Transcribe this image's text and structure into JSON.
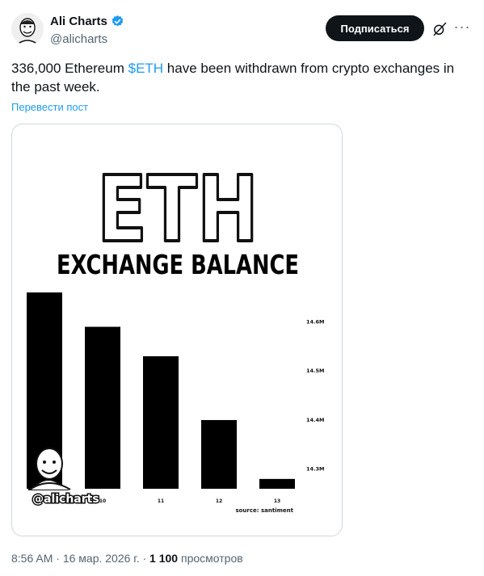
{
  "author": {
    "display_name": "Ali Charts",
    "handle": "@alicharts"
  },
  "actions": {
    "subscribe_label": "Подписаться"
  },
  "tweet": {
    "text_before": "336,000 Ethereum ",
    "cashtag": "$ETH",
    "text_after": " have been withdrawn from crypto exchanges in the past week.",
    "translate_label": "Перевести пост"
  },
  "meta": {
    "time": "8:56 AM",
    "date": "16 мар. 2026 г.",
    "views_count": "1 100",
    "views_label": "просмотров"
  },
  "image": {
    "big_title": "ETH",
    "subtitle": "EXCHANGE BALANCE",
    "watermark": "@alicharts",
    "source_note": "source: santiment"
  },
  "colors": {
    "accent": "#1d9bf0",
    "text": "#0f1419",
    "muted": "#536471",
    "bar": "#000000"
  },
  "chart_data": {
    "type": "bar",
    "categories": [
      "9",
      "10",
      "11",
      "12",
      "13"
    ],
    "category_labels_shown": [
      "",
      "10",
      "11",
      "12",
      "13"
    ],
    "values": [
      14.66,
      14.59,
      14.53,
      14.4,
      14.28
    ],
    "unit": "M",
    "ylim": [
      14.26,
      14.66
    ],
    "yticks": [
      14.3,
      14.4,
      14.5,
      14.6
    ],
    "ytick_labels": [
      "14.3M",
      "14.4M",
      "14.5M",
      "14.6M"
    ],
    "title": "EXCHANGE BALANCE",
    "xlabel": "",
    "ylabel": "",
    "grid": false
  }
}
